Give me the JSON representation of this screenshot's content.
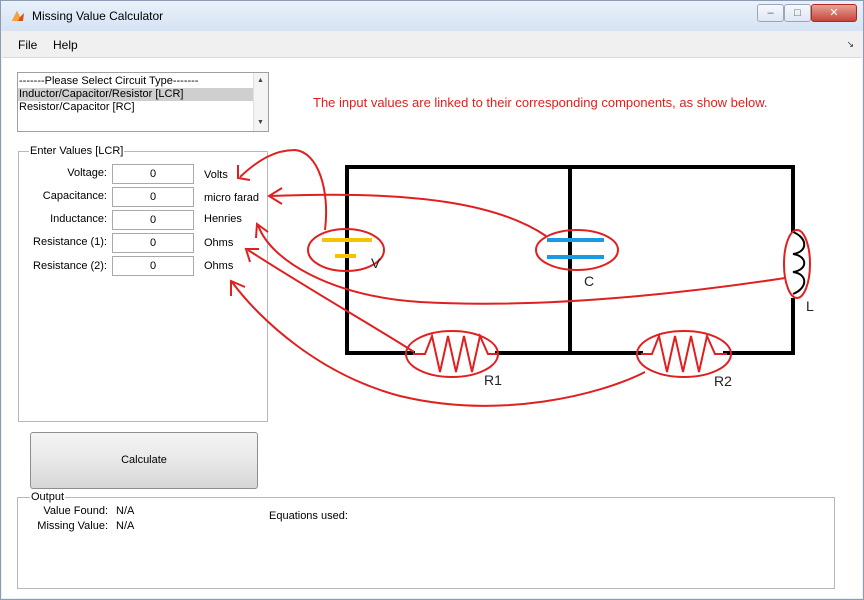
{
  "window": {
    "title": "Missing Value Calculator",
    "controls": {
      "minimize": "–",
      "maximize": "□",
      "close": "✕"
    }
  },
  "menu": {
    "file": "File",
    "help": "Help",
    "overflow_icon": "↘"
  },
  "circuit_list": {
    "items": [
      "-------Please Select Circuit Type-------",
      "Inductor/Capacitor/Resistor [LCR]",
      "Resistor/Capacitor [RC]"
    ],
    "selected_index": 1
  },
  "inputs": {
    "group_title": "Enter Values [LCR]",
    "fields": [
      {
        "label": "Voltage:",
        "value": "0",
        "unit": "Volts"
      },
      {
        "label": "Capacitance:",
        "value": "0",
        "unit": "micro farad"
      },
      {
        "label": "Inductance:",
        "value": "0",
        "unit": "Henries"
      },
      {
        "label": "Resistance (1):",
        "value": "0",
        "unit": "Ohms"
      },
      {
        "label": "Resistance (2):",
        "value": "0",
        "unit": "Ohms"
      }
    ]
  },
  "calculate_label": "Calculate",
  "output": {
    "group_title": "Output",
    "value_found_label": "Value Found:",
    "value_found": "N/A",
    "missing_value_label": "Missing Value:",
    "missing_value": "N/A",
    "equations_label": "Equations used:"
  },
  "diagram": {
    "note": "The input values are linked to their corresponding components, as show below.",
    "labels": {
      "voltage": "V",
      "capacitor": "C",
      "inductor": "L",
      "resistor1": "R1",
      "resistor2": "R2"
    },
    "colors": {
      "annotation": "#e02020",
      "battery": "#f5c400",
      "capacitor": "#1a9ae0",
      "wire": "#000000"
    }
  }
}
